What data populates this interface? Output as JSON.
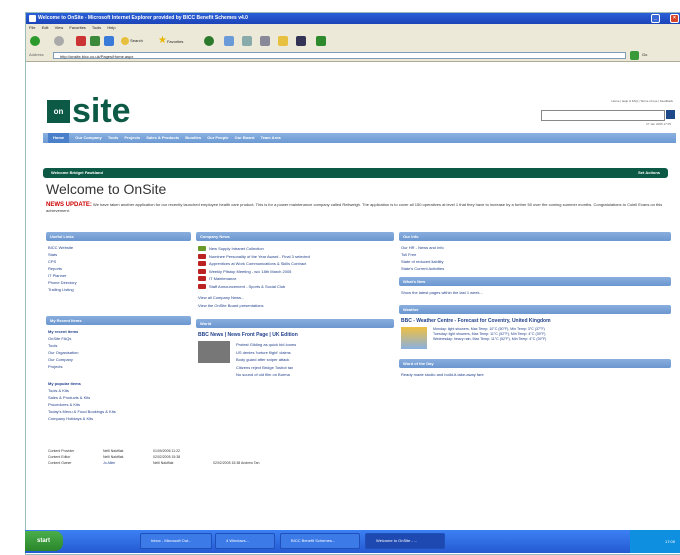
{
  "window": {
    "title": "Welcome to OnSite - Microsoft Internet Explorer provided by BICC Benefit Schemes v4.0"
  },
  "menu": [
    "File",
    "Edit",
    "View",
    "Favorites",
    "Tools",
    "Help"
  ],
  "toolbar": {
    "search": "Search",
    "favorites": "Favorites"
  },
  "address": {
    "label": "Address",
    "url": "http://onsite.bicc.co.uk/Pages/Home.aspx",
    "go": "Go"
  },
  "site": {
    "logo_on": "on",
    "logo_site": "site",
    "toplinks": "Home | Help & FAQ | Terms of use | Feedback",
    "date": "27 Jan 2005 17:05",
    "nav": [
      "Home",
      "Our Company",
      "Tools",
      "Projects",
      "Sales & Products",
      "Bundles",
      "Our People",
      "Our Board",
      "Team Area"
    ],
    "welcome_bar": "Welcome Bridget Fawkland",
    "welcome_actions": "Set Actions",
    "page_title": "Welcome to OnSite",
    "news_label": "NEWS UPDATE:",
    "news_text": "We have taken another application for our recently launched employee health care product. This is for a power maintenance company called Reitweigh. The application is to cover all 150 operatives at level 1 that they have to increase by a further 50 over the coming summer months. Congratulations to Coleil Evans on this achievement.",
    "useful_links": {
      "title": "Useful Links",
      "items": [
        "BICC Website",
        "Stats",
        "CPS",
        "Reports",
        "IT Planner",
        "Phone Directory",
        "Trailing Listing"
      ]
    },
    "recent": {
      "title": "My Recent Items",
      "subtitle": "My recent items",
      "items": [
        "OnSite FAQs",
        "Tools",
        "Our Organisation",
        "Our Company",
        "Projects"
      ]
    },
    "popular": {
      "subtitle": "My popular items",
      "items": [
        "Tools & Kits",
        "Sales & Products & Kits",
        "Procedures & Kits",
        "Today's Menu & Food Bookings & Kits",
        "Company Holidays & Kits"
      ]
    },
    "company_news": {
      "title": "Company News",
      "items": [
        "New Supply Intranet Collection",
        "Nominee Personality of the Year Award - Final 3 selected",
        "Apprentices at Work Communications & Skills Contract",
        "Weekly Pitstop Meeting - w/c 18th March 2005",
        "IT Maintenance",
        "Staff Announcement - Sports & Social Club"
      ],
      "link_all": "View all Company News...",
      "link_archive": "View the OnSite Board presentations"
    },
    "world": {
      "title": "World",
      "headline": "BBC News | News Front Page | UK Edition",
      "items": [
        "Protest Gilding as quick bid looms",
        "US denies 'torture flight' claims",
        "Body guard after sniper attack",
        "Citizens reject Bridge Toshot tax",
        "No sound of old film on Burma"
      ]
    },
    "our_info": {
      "title": "Our Info",
      "items": [
        "Our HR - News and Info",
        "Toll Free",
        "State of reduced liability",
        "State's Current Activities"
      ]
    },
    "whats_new": {
      "title": "What's New",
      "text": "Show the latest pages within the last 1 week..."
    },
    "weather": {
      "title": "Weather",
      "headline": "BBC - Weather Centre - Forecast for Coventry, United Kingdom",
      "lines": [
        "Monday: light showers, Max Temp: 10°C (50°F), Min Temp: 3°C (37°F)",
        "Tuesday: light showers, Max Temp: 11°C (52°F), Min Temp: 4°C (39°F)",
        "Wednesday: heavy rain, Max Temp: 11°C (52°F), Min Temp: 4°C (39°F)"
      ]
    },
    "word_of_day": {
      "title": "Word of the Day",
      "text": "Ready made studio and build-it-take-away fare"
    },
    "footer": {
      "rows": [
        [
          "Content Provider",
          "Nelli Naktflak",
          "01/09/2005 11:22",
          ""
        ],
        [
          "Content Editor",
          "Nelli Naktflak",
          "02/02/2005 15:38",
          ""
        ],
        [
          "Content Owner",
          "Jo Allen",
          "Nelli Naktflak",
          "02/02/2005 15:38 Andrew Tan"
        ]
      ]
    }
  },
  "status": {
    "left": "Done",
    "right": "Local intranet"
  },
  "taskbar": {
    "start": "start",
    "tasks": [
      "Inbox - Microsoft Out...",
      "4 Windows...",
      "BICC Benefit Schemes...",
      "Welcome to OnSite - ..."
    ],
    "tray": "17:05"
  }
}
